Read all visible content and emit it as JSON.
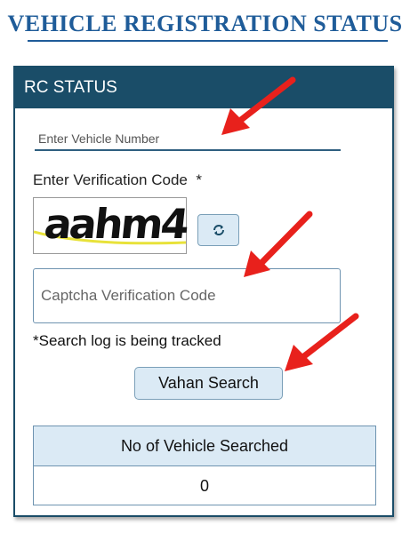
{
  "page": {
    "title": "VEHICLE REGISTRATION STATUS"
  },
  "panel": {
    "header": "RC STATUS",
    "vehicle_input": {
      "placeholder": "Enter Vehicle Number",
      "value": ""
    },
    "verification_label": "Enter Verification Code  *",
    "captcha": {
      "text": "aahm4",
      "line_color": "#e8e23a"
    },
    "refresh_icon": "refresh-icon",
    "captcha_input": {
      "placeholder": "Captcha Verification Code",
      "value": ""
    },
    "tracking_note": "*Search log is being tracked",
    "search_button": "Vahan Search",
    "counter": {
      "header": "No of Vehicle Searched",
      "value": "0"
    }
  },
  "annotations": {
    "arrow_color": "#e8211c"
  },
  "colors": {
    "header_bg": "#1a4d68",
    "title": "#1f5c99",
    "button_bg": "#dbeaf5"
  }
}
